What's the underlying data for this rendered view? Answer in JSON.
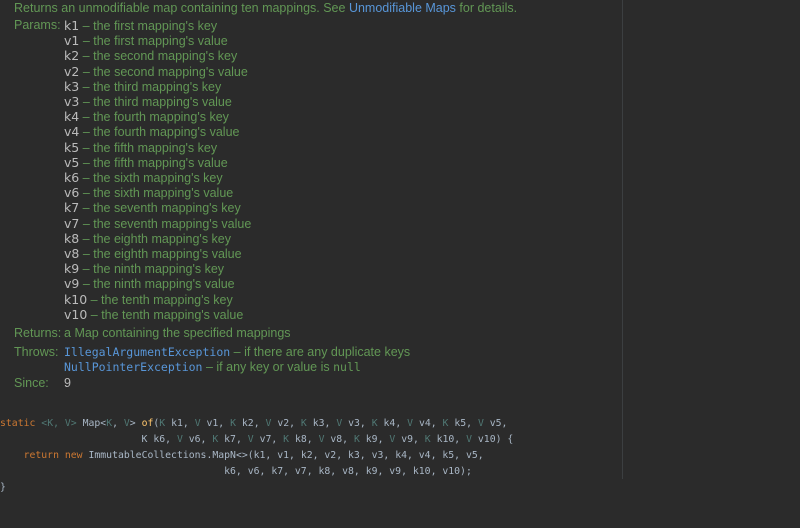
{
  "doc": {
    "summary_text": "Returns an unmodifiable map containing ten mappings. See ",
    "summary_link": "Unmodifiable Maps",
    "summary_tail": " for details.",
    "params_label": "Params:",
    "params": [
      {
        "name": "k1",
        "desc": " – the first mapping's key"
      },
      {
        "name": "v1",
        "desc": " – the first mapping's value"
      },
      {
        "name": "k2",
        "desc": " – the second mapping's key"
      },
      {
        "name": "v2",
        "desc": " – the second mapping's value"
      },
      {
        "name": "k3",
        "desc": " – the third mapping's key"
      },
      {
        "name": "v3",
        "desc": " – the third mapping's value"
      },
      {
        "name": "k4",
        "desc": " – the fourth mapping's key"
      },
      {
        "name": "v4",
        "desc": " – the fourth mapping's value"
      },
      {
        "name": "k5",
        "desc": " – the fifth mapping's key"
      },
      {
        "name": "v5",
        "desc": " – the fifth mapping's value"
      },
      {
        "name": "k6",
        "desc": " – the sixth mapping's key"
      },
      {
        "name": "v6",
        "desc": " – the sixth mapping's value"
      },
      {
        "name": "k7",
        "desc": " – the seventh mapping's key"
      },
      {
        "name": "v7",
        "desc": " – the seventh mapping's value"
      },
      {
        "name": "k8",
        "desc": " – the eighth mapping's key"
      },
      {
        "name": "v8",
        "desc": " – the eighth mapping's value"
      },
      {
        "name": "k9",
        "desc": " – the ninth mapping's key"
      },
      {
        "name": "v9",
        "desc": " – the ninth mapping's value"
      },
      {
        "name": "k10",
        "desc": " – the tenth mapping's key"
      },
      {
        "name": "v10",
        "desc": " – the tenth mapping's value"
      }
    ],
    "returns_label": "Returns:",
    "returns_a": "a ",
    "returns_code": "Map",
    "returns_tail": " containing the specified mappings",
    "throws_label": "Throws:",
    "throws": [
      {
        "exception": "IllegalArgumentException",
        "sep": " – ",
        "desc": "if there are any duplicate keys",
        "extra": ""
      },
      {
        "exception": "NullPointerException",
        "sep": " – ",
        "desc": "if any key or value is ",
        "extra": "null"
      }
    ],
    "since_label": "Since:",
    "since_value": "9"
  },
  "code": {
    "line1": {
      "static": "static ",
      "generic": "<K, V> ",
      "map": "Map<",
      "mk": "K",
      "mcomma": ", ",
      "mv": "V",
      "mclose": "> ",
      "fn": "of",
      "rest": "(K k1, V v1, K k2, V v2, K k3, V v3, K k4, V v4, K k5, V v5,"
    },
    "line2": "                        K k6, V v6, K k7, V v7, K k8, V v8, K k9, V v9, K k10, V v10) {",
    "line3_kw": "    return new ",
    "line3_rest": "ImmutableCollections.MapN<>(k1, v1, k2, v2, k3, v3, k4, v4, k5, v5,",
    "line4": "                                      k6, v6, k7, v7, k8, v8, k9, v9, k10, v10);",
    "line5": "}"
  },
  "colors": {
    "background": "#2b2b2b",
    "doc_text": "#629755",
    "link": "#5896d8",
    "param_name": "#bbbbbb",
    "keyword": "#cc7832",
    "type_param": "#507874",
    "function": "#ffc66d",
    "code_text": "#a9b7c6"
  }
}
